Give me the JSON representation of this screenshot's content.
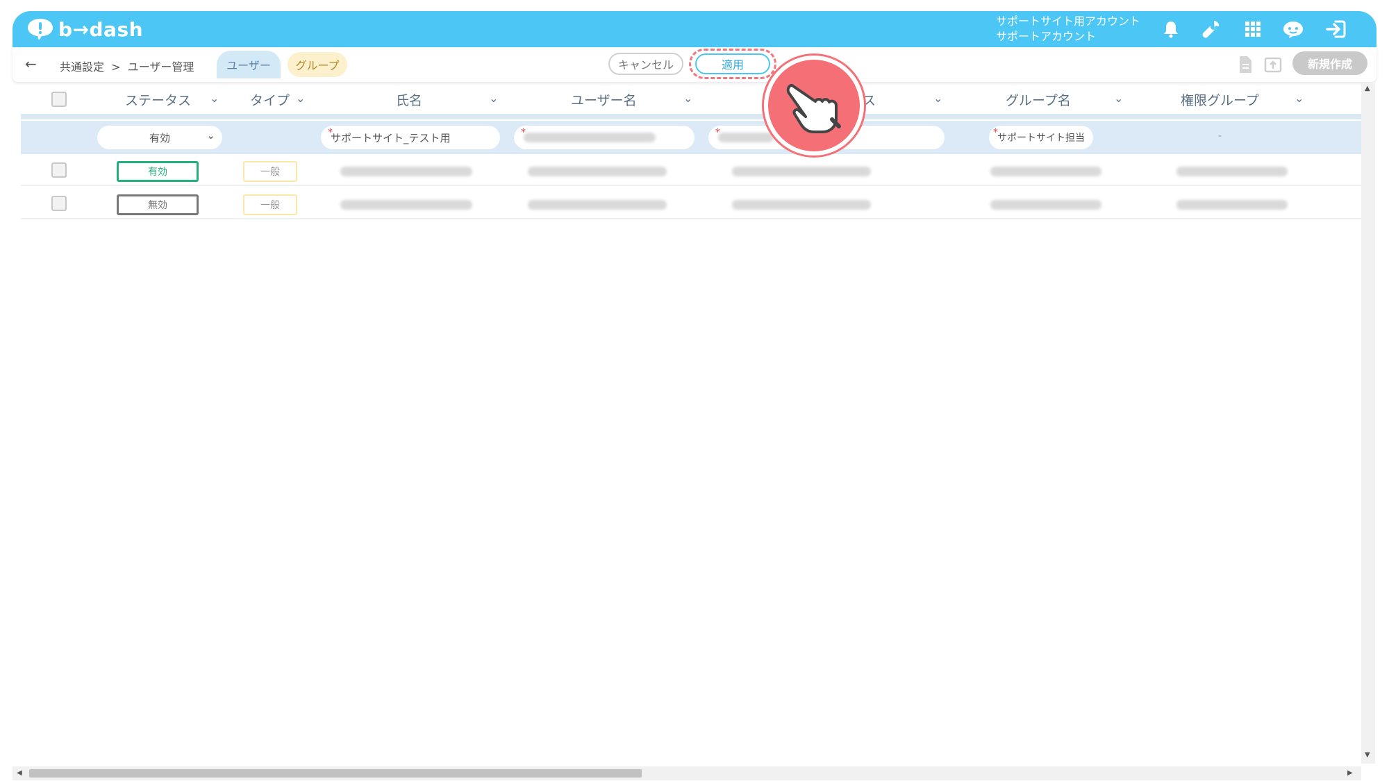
{
  "header": {
    "brand": "b→dash",
    "account_line1": "サポートサイト用アカウント",
    "account_line2": "サポートアカウント",
    "icons": [
      "bell-icon",
      "wrench-icon",
      "grid-icon",
      "support-chat-icon",
      "logout-icon"
    ]
  },
  "toolbar": {
    "back_symbol": "←",
    "breadcrumb": "共通設定  >  ユーザー管理",
    "tab_user": "ユーザー",
    "tab_group": "グループ",
    "cancel_label": "キャンセル",
    "apply_label": "適用",
    "new_label": "新規作成"
  },
  "table": {
    "columns": [
      "ステータス",
      "タイプ",
      "氏名",
      "ユーザー名",
      "ス",
      "グループ名",
      "権限グループ"
    ],
    "filters": {
      "status": "有効",
      "name": "サポートサイト_テスト用",
      "group": "サポートサイト担当",
      "permission": "-"
    },
    "rows": [
      {
        "status": "有効",
        "type": "一般"
      },
      {
        "status": "無効",
        "type": "一般"
      }
    ]
  },
  "colors": {
    "brand": "#4cc6f4",
    "active_status": "#22b07d",
    "inactive_status": "#777777",
    "type_border": "#fbe7a8",
    "highlight": "#f56f77"
  }
}
